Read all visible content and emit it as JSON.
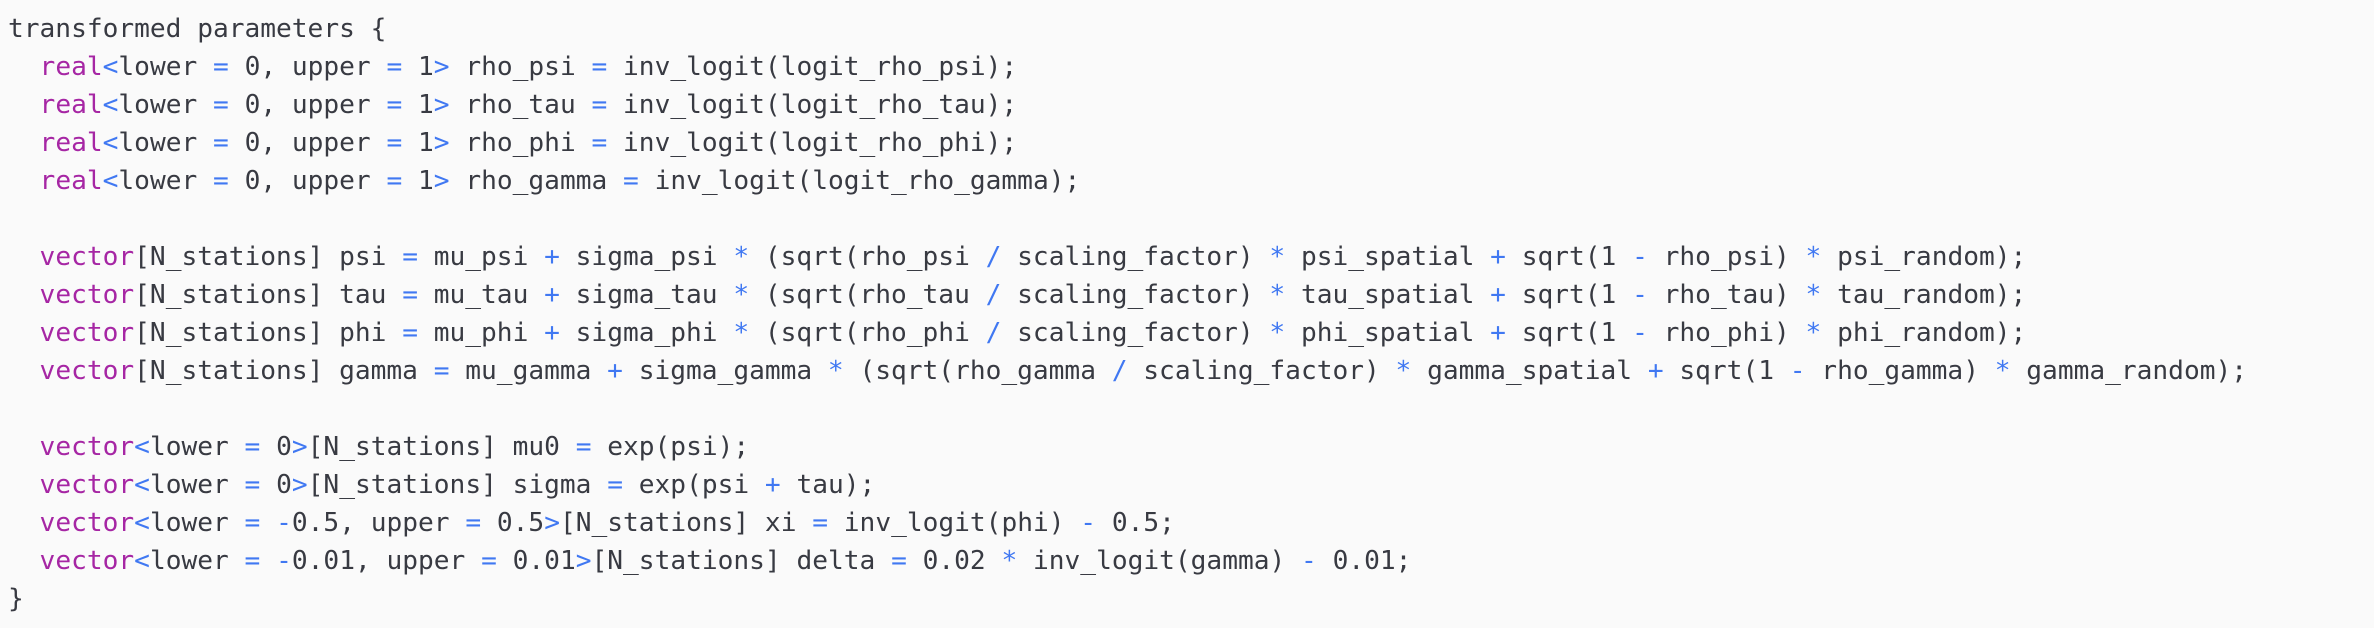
{
  "colors": {
    "background": "#fafafa",
    "text": "#383a42",
    "type_keyword": "#a626a4",
    "operator": "#4078f2"
  },
  "code": {
    "lines": [
      [
        {
          "t": "transformed parameters {",
          "c": "id"
        }
      ],
      [
        {
          "t": "  ",
          "c": "id"
        },
        {
          "t": "real",
          "c": "type"
        },
        {
          "t": "<",
          "c": "op"
        },
        {
          "t": "lower ",
          "c": "id"
        },
        {
          "t": "=",
          "c": "op"
        },
        {
          "t": " 0, upper ",
          "c": "id"
        },
        {
          "t": "=",
          "c": "op"
        },
        {
          "t": " 1",
          "c": "id"
        },
        {
          "t": ">",
          "c": "op"
        },
        {
          "t": " rho_psi ",
          "c": "id"
        },
        {
          "t": "=",
          "c": "op"
        },
        {
          "t": " inv_logit(logit_rho_psi);",
          "c": "id"
        }
      ],
      [
        {
          "t": "  ",
          "c": "id"
        },
        {
          "t": "real",
          "c": "type"
        },
        {
          "t": "<",
          "c": "op"
        },
        {
          "t": "lower ",
          "c": "id"
        },
        {
          "t": "=",
          "c": "op"
        },
        {
          "t": " 0, upper ",
          "c": "id"
        },
        {
          "t": "=",
          "c": "op"
        },
        {
          "t": " 1",
          "c": "id"
        },
        {
          "t": ">",
          "c": "op"
        },
        {
          "t": " rho_tau ",
          "c": "id"
        },
        {
          "t": "=",
          "c": "op"
        },
        {
          "t": " inv_logit(logit_rho_tau);",
          "c": "id"
        }
      ],
      [
        {
          "t": "  ",
          "c": "id"
        },
        {
          "t": "real",
          "c": "type"
        },
        {
          "t": "<",
          "c": "op"
        },
        {
          "t": "lower ",
          "c": "id"
        },
        {
          "t": "=",
          "c": "op"
        },
        {
          "t": " 0, upper ",
          "c": "id"
        },
        {
          "t": "=",
          "c": "op"
        },
        {
          "t": " 1",
          "c": "id"
        },
        {
          "t": ">",
          "c": "op"
        },
        {
          "t": " rho_phi ",
          "c": "id"
        },
        {
          "t": "=",
          "c": "op"
        },
        {
          "t": " inv_logit(logit_rho_phi);",
          "c": "id"
        }
      ],
      [
        {
          "t": "  ",
          "c": "id"
        },
        {
          "t": "real",
          "c": "type"
        },
        {
          "t": "<",
          "c": "op"
        },
        {
          "t": "lower ",
          "c": "id"
        },
        {
          "t": "=",
          "c": "op"
        },
        {
          "t": " 0, upper ",
          "c": "id"
        },
        {
          "t": "=",
          "c": "op"
        },
        {
          "t": " 1",
          "c": "id"
        },
        {
          "t": ">",
          "c": "op"
        },
        {
          "t": " rho_gamma ",
          "c": "id"
        },
        {
          "t": "=",
          "c": "op"
        },
        {
          "t": " inv_logit(logit_rho_gamma);",
          "c": "id"
        }
      ],
      [
        {
          "t": "",
          "c": "id"
        }
      ],
      [
        {
          "t": "  ",
          "c": "id"
        },
        {
          "t": "vector",
          "c": "type"
        },
        {
          "t": "[N_stations] psi ",
          "c": "id"
        },
        {
          "t": "=",
          "c": "op"
        },
        {
          "t": " mu_psi ",
          "c": "id"
        },
        {
          "t": "+",
          "c": "op"
        },
        {
          "t": " sigma_psi ",
          "c": "id"
        },
        {
          "t": "*",
          "c": "op"
        },
        {
          "t": " (sqrt(rho_psi ",
          "c": "id"
        },
        {
          "t": "/",
          "c": "op"
        },
        {
          "t": " scaling_factor) ",
          "c": "id"
        },
        {
          "t": "*",
          "c": "op"
        },
        {
          "t": " psi_spatial ",
          "c": "id"
        },
        {
          "t": "+",
          "c": "op"
        },
        {
          "t": " sqrt(1 ",
          "c": "id"
        },
        {
          "t": "-",
          "c": "op"
        },
        {
          "t": " rho_psi) ",
          "c": "id"
        },
        {
          "t": "*",
          "c": "op"
        },
        {
          "t": " psi_random);",
          "c": "id"
        }
      ],
      [
        {
          "t": "  ",
          "c": "id"
        },
        {
          "t": "vector",
          "c": "type"
        },
        {
          "t": "[N_stations] tau ",
          "c": "id"
        },
        {
          "t": "=",
          "c": "op"
        },
        {
          "t": " mu_tau ",
          "c": "id"
        },
        {
          "t": "+",
          "c": "op"
        },
        {
          "t": " sigma_tau ",
          "c": "id"
        },
        {
          "t": "*",
          "c": "op"
        },
        {
          "t": " (sqrt(rho_tau ",
          "c": "id"
        },
        {
          "t": "/",
          "c": "op"
        },
        {
          "t": " scaling_factor) ",
          "c": "id"
        },
        {
          "t": "*",
          "c": "op"
        },
        {
          "t": " tau_spatial ",
          "c": "id"
        },
        {
          "t": "+",
          "c": "op"
        },
        {
          "t": " sqrt(1 ",
          "c": "id"
        },
        {
          "t": "-",
          "c": "op"
        },
        {
          "t": " rho_tau) ",
          "c": "id"
        },
        {
          "t": "*",
          "c": "op"
        },
        {
          "t": " tau_random);",
          "c": "id"
        }
      ],
      [
        {
          "t": "  ",
          "c": "id"
        },
        {
          "t": "vector",
          "c": "type"
        },
        {
          "t": "[N_stations] phi ",
          "c": "id"
        },
        {
          "t": "=",
          "c": "op"
        },
        {
          "t": " mu_phi ",
          "c": "id"
        },
        {
          "t": "+",
          "c": "op"
        },
        {
          "t": " sigma_phi ",
          "c": "id"
        },
        {
          "t": "*",
          "c": "op"
        },
        {
          "t": " (sqrt(rho_phi ",
          "c": "id"
        },
        {
          "t": "/",
          "c": "op"
        },
        {
          "t": " scaling_factor) ",
          "c": "id"
        },
        {
          "t": "*",
          "c": "op"
        },
        {
          "t": " phi_spatial ",
          "c": "id"
        },
        {
          "t": "+",
          "c": "op"
        },
        {
          "t": " sqrt(1 ",
          "c": "id"
        },
        {
          "t": "-",
          "c": "op"
        },
        {
          "t": " rho_phi) ",
          "c": "id"
        },
        {
          "t": "*",
          "c": "op"
        },
        {
          "t": " phi_random);",
          "c": "id"
        }
      ],
      [
        {
          "t": "  ",
          "c": "id"
        },
        {
          "t": "vector",
          "c": "type"
        },
        {
          "t": "[N_stations] gamma ",
          "c": "id"
        },
        {
          "t": "=",
          "c": "op"
        },
        {
          "t": " mu_gamma ",
          "c": "id"
        },
        {
          "t": "+",
          "c": "op"
        },
        {
          "t": " sigma_gamma ",
          "c": "id"
        },
        {
          "t": "*",
          "c": "op"
        },
        {
          "t": " (sqrt(rho_gamma ",
          "c": "id"
        },
        {
          "t": "/",
          "c": "op"
        },
        {
          "t": " scaling_factor) ",
          "c": "id"
        },
        {
          "t": "*",
          "c": "op"
        },
        {
          "t": " gamma_spatial ",
          "c": "id"
        },
        {
          "t": "+",
          "c": "op"
        },
        {
          "t": " sqrt(1 ",
          "c": "id"
        },
        {
          "t": "-",
          "c": "op"
        },
        {
          "t": " rho_gamma) ",
          "c": "id"
        },
        {
          "t": "*",
          "c": "op"
        },
        {
          "t": " gamma_random);",
          "c": "id"
        }
      ],
      [
        {
          "t": "",
          "c": "id"
        }
      ],
      [
        {
          "t": "  ",
          "c": "id"
        },
        {
          "t": "vector",
          "c": "type"
        },
        {
          "t": "<",
          "c": "op"
        },
        {
          "t": "lower ",
          "c": "id"
        },
        {
          "t": "=",
          "c": "op"
        },
        {
          "t": " 0",
          "c": "id"
        },
        {
          "t": ">",
          "c": "op"
        },
        {
          "t": "[N_stations] mu0 ",
          "c": "id"
        },
        {
          "t": "=",
          "c": "op"
        },
        {
          "t": " exp(psi);",
          "c": "id"
        }
      ],
      [
        {
          "t": "  ",
          "c": "id"
        },
        {
          "t": "vector",
          "c": "type"
        },
        {
          "t": "<",
          "c": "op"
        },
        {
          "t": "lower ",
          "c": "id"
        },
        {
          "t": "=",
          "c": "op"
        },
        {
          "t": " 0",
          "c": "id"
        },
        {
          "t": ">",
          "c": "op"
        },
        {
          "t": "[N_stations] sigma ",
          "c": "id"
        },
        {
          "t": "=",
          "c": "op"
        },
        {
          "t": " exp(psi ",
          "c": "id"
        },
        {
          "t": "+",
          "c": "op"
        },
        {
          "t": " tau);",
          "c": "id"
        }
      ],
      [
        {
          "t": "  ",
          "c": "id"
        },
        {
          "t": "vector",
          "c": "type"
        },
        {
          "t": "<",
          "c": "op"
        },
        {
          "t": "lower ",
          "c": "id"
        },
        {
          "t": "=",
          "c": "op"
        },
        {
          "t": " ",
          "c": "id"
        },
        {
          "t": "-",
          "c": "op"
        },
        {
          "t": "0.5, upper ",
          "c": "id"
        },
        {
          "t": "=",
          "c": "op"
        },
        {
          "t": " 0.5",
          "c": "id"
        },
        {
          "t": ">",
          "c": "op"
        },
        {
          "t": "[N_stations] xi ",
          "c": "id"
        },
        {
          "t": "=",
          "c": "op"
        },
        {
          "t": " inv_logit(phi) ",
          "c": "id"
        },
        {
          "t": "-",
          "c": "op"
        },
        {
          "t": " 0.5;",
          "c": "id"
        }
      ],
      [
        {
          "t": "  ",
          "c": "id"
        },
        {
          "t": "vector",
          "c": "type"
        },
        {
          "t": "<",
          "c": "op"
        },
        {
          "t": "lower ",
          "c": "id"
        },
        {
          "t": "=",
          "c": "op"
        },
        {
          "t": " ",
          "c": "id"
        },
        {
          "t": "-",
          "c": "op"
        },
        {
          "t": "0.01, upper ",
          "c": "id"
        },
        {
          "t": "=",
          "c": "op"
        },
        {
          "t": " 0.01",
          "c": "id"
        },
        {
          "t": ">",
          "c": "op"
        },
        {
          "t": "[N_stations] delta ",
          "c": "id"
        },
        {
          "t": "=",
          "c": "op"
        },
        {
          "t": " 0.02 ",
          "c": "id"
        },
        {
          "t": "*",
          "c": "op"
        },
        {
          "t": " inv_logit(gamma) ",
          "c": "id"
        },
        {
          "t": "-",
          "c": "op"
        },
        {
          "t": " 0.01;",
          "c": "id"
        }
      ],
      [
        {
          "t": "}",
          "c": "id"
        }
      ]
    ]
  }
}
